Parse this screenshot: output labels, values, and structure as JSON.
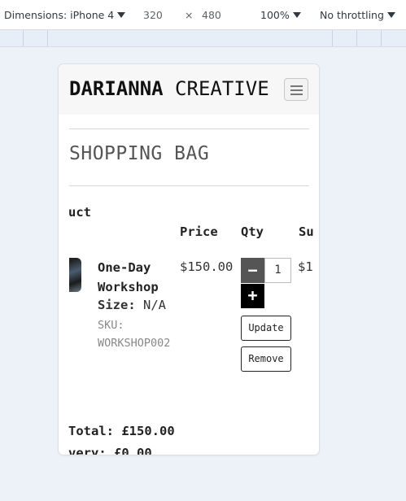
{
  "devtools": {
    "device_label": "Dimensions: iPhone 4",
    "width": "320",
    "times": "×",
    "height": "480",
    "zoom": "100%",
    "throttle": "No throttling"
  },
  "site": {
    "brand_bold": "DARIANNA",
    "brand_rest": " CREATIVE",
    "page_title": "SHOPPING BAG"
  },
  "table": {
    "headers": [
      "uct",
      "Price",
      "Qty",
      "Su"
    ]
  },
  "item": {
    "name_line1": "One-Day",
    "name_line2": "Workshop",
    "size_label": "Size:",
    "size_value": " N/A",
    "sku_label": "SKU:",
    "sku_value": "WORKSHOP002",
    "price": "$150.00",
    "qty_minus": "−",
    "quantity": "1",
    "qty_plus": "+",
    "update_label": "Update",
    "remove_label": "Remove",
    "subtotal_partial": "$1"
  },
  "summary": {
    "total": "Total: £150.00",
    "delivery_partial": "very: £0.00"
  }
}
